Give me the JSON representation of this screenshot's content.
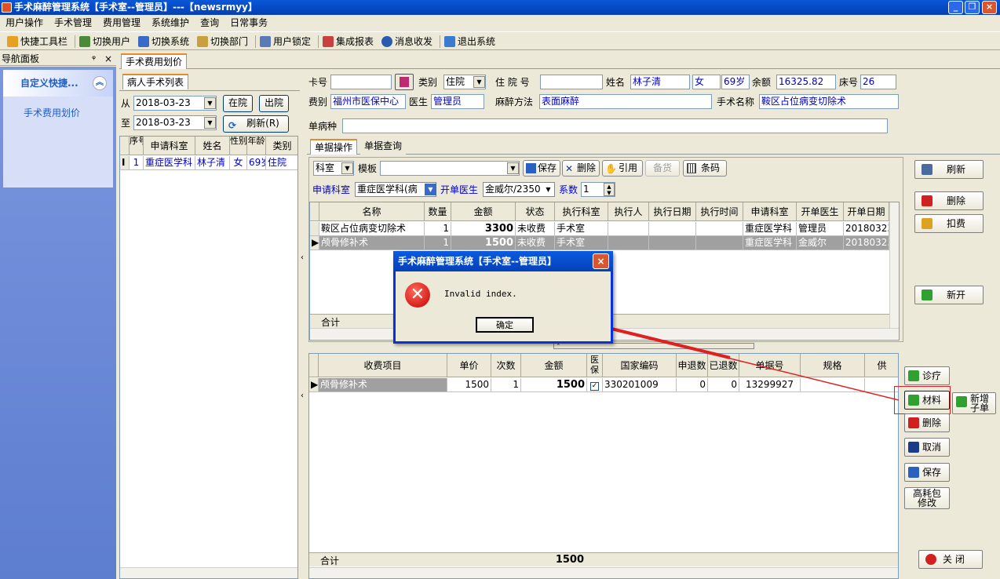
{
  "window": {
    "title": "手术麻醉管理系统【手术室--管理员】---【newsrmyy】"
  },
  "menu": [
    "用户操作",
    "手术管理",
    "费用管理",
    "系统维护",
    "查询",
    "日常事务"
  ],
  "toolbar": [
    "快捷工具栏",
    "切换用户",
    "切换系统",
    "切换部门",
    "用户锁定",
    "集成报表",
    "消息收发",
    "退出系统"
  ],
  "nav": {
    "header": "导航面板",
    "pin": "ᵠ",
    "close": "×",
    "group_title": "自定义快捷...",
    "item": "手术费用划价"
  },
  "main_tab": "手术费用划价",
  "left": {
    "tab": "病人手术列表",
    "from_label": "从",
    "from_date": "2018-03-23",
    "to_label": "至",
    "to_date": "2018-03-23",
    "btn_inhosp": "在院",
    "btn_outhosp": "出院",
    "btn_refresh": "刷新(R)",
    "columns": [
      "序号",
      "申请科室",
      "姓名",
      "性别",
      "年龄",
      "类别"
    ],
    "row": {
      "marker": "I",
      "no": "1",
      "dept": "重症医学科",
      "name": "林子清",
      "sex": "女",
      "age": "69岁",
      "type": "住院"
    }
  },
  "patient": {
    "card_label": "卡号",
    "card_value": "",
    "category_label": "类别",
    "category_value": "住院",
    "inpatient_label": "住 院 号",
    "inpatient_value": "",
    "name_label": "姓名",
    "name_value": "林子清",
    "sex_value": "女",
    "age_value": "69岁",
    "balance_label": "余额",
    "balance_value": "16325.82",
    "bed_label": "床号",
    "bed_value": "26",
    "fee_label": "费别",
    "fee_value": "福州市医保中心",
    "doctor_label": "医生",
    "doctor_value": "管理员",
    "anes_label": "麻醉方法",
    "anes_value": "表面麻醉",
    "surgery_label": "手术名称",
    "surgery_value": "鞍区占位病变切除术",
    "disease_label": "单病种",
    "disease_value": ""
  },
  "doc_tabs": [
    "单据操作",
    "单据查询"
  ],
  "doc_toolbar": {
    "dept": "科室",
    "template_label": "模板",
    "template_value": "",
    "save": "保存",
    "delete": "删除",
    "cite": "引用",
    "backup": "备货",
    "barcode": "条码"
  },
  "req": {
    "dept_label": "申请科室",
    "dept_value": "重症医学科(病",
    "doctor_label": "开单医生",
    "doctor_value": "金威尔/2350",
    "count_label": "系数",
    "count_value": "1"
  },
  "upper_grid": {
    "columns": [
      "名称",
      "数量",
      "金额",
      "状态",
      "执行科室",
      "执行人",
      "执行日期",
      "执行时间",
      "申请科室",
      "开单医生",
      "开单日期"
    ],
    "rows": [
      {
        "name": "鞍区占位病变切除术",
        "qty": "1",
        "amount": "3300",
        "status": "未收费",
        "exec_dept": "手术室",
        "req_dept": "重症医学科",
        "doctor": "管理员",
        "date": "20180323"
      },
      {
        "name": "颅骨修补术",
        "qty": "1",
        "amount": "1500",
        "status": "未收费",
        "exec_dept": "手术室",
        "req_dept": "重症医学科",
        "doctor": "金威尔",
        "date": "20180323"
      }
    ],
    "total_label": "合计"
  },
  "right_buttons": {
    "refresh": "刷新",
    "delete": "删除",
    "deduct": "扣费",
    "new": "新开"
  },
  "lower_grid": {
    "columns": [
      "收费项目",
      "单价",
      "次数",
      "金额",
      "医保",
      "国家编码",
      "申退数",
      "已退数",
      "单据号",
      "规格",
      "供"
    ],
    "row": {
      "item": "颅骨修补术",
      "price": "1500",
      "times": "1",
      "amount": "1500",
      "insurance": "✓",
      "code": "330201009",
      "applied": "0",
      "returned": "0",
      "doc_no": "13299927"
    },
    "total_label": "合计",
    "total_amount": "1500"
  },
  "lower_buttons": {
    "clinic": "诊疗",
    "material": "材料",
    "new_sub1": "新增",
    "new_sub2": "子单",
    "delete": "删除",
    "cancel": "取消",
    "save": "保存",
    "hc1": "高耗包",
    "hc2": "修改",
    "close": "关 闭"
  },
  "dialog": {
    "title": "手术麻醉管理系统【手术室--管理员】",
    "message": "Invalid index.",
    "ok": "确定"
  },
  "colors": {
    "accent": "#0A58D6",
    "nav": "#6B8AD9",
    "error": "#C40000",
    "annotation": "#E02020"
  }
}
